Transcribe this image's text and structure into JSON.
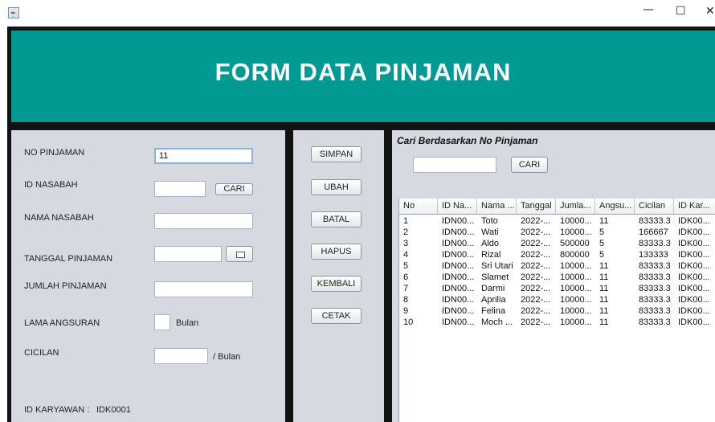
{
  "window": {
    "minimize": "—",
    "maximize": "☐",
    "close": "✕"
  },
  "header": {
    "title": "FORM DATA PINJAMAN"
  },
  "form": {
    "no_pinjaman_label": "NO PINJAMAN",
    "no_pinjaman_value": "11",
    "id_nasabah_label": "ID NASABAH",
    "id_nasabah_value": "",
    "cari_label": "CARI",
    "nama_nasabah_label": "NAMA NASABAH",
    "nama_nasabah_value": "",
    "tanggal_label": "TANGGAL PINJAMAN",
    "tanggal_value": "",
    "jumlah_label": "JUMLAH PINJAMAN",
    "jumlah_value": "",
    "lama_label": "LAMA ANGSURAN",
    "lama_value": "",
    "bulan_label": "Bulan",
    "cicilan_label": "CICILAN",
    "cicilan_value": "",
    "per_bulan_label": "/ Bulan",
    "id_karyawan_label": "ID KARYAWAN :",
    "id_karyawan_value": "IDK0001"
  },
  "actions": {
    "simpan": "SIMPAN",
    "ubah": "UBAH",
    "batal": "BATAL",
    "hapus": "HAPUS",
    "kembali": "KEMBALI",
    "cetak": "CETAK"
  },
  "search": {
    "title": "Cari Berdasarkan No Pinjaman",
    "value": "",
    "button": "CARI"
  },
  "table": {
    "headers": [
      "No",
      "ID Na...",
      "Nama ...",
      "Tanggal",
      "Jumla...",
      "Angsu...",
      "Cicilan",
      "ID Kar..."
    ],
    "rows": [
      [
        "1",
        "IDN00...",
        "Toto",
        "2022-...",
        "10000...",
        "11",
        "83333.3",
        "IDK00..."
      ],
      [
        "2",
        "IDN00...",
        "Wati",
        "2022-...",
        "10000...",
        "5",
        "166667",
        "IDK00..."
      ],
      [
        "3",
        "IDN00...",
        "Aldo",
        "2022-...",
        "500000",
        "5",
        "83333.3",
        "IDK00..."
      ],
      [
        "4",
        "IDN00...",
        "Rizal",
        "2022-...",
        "800000",
        "5",
        "133333",
        "IDK00..."
      ],
      [
        "5",
        "IDN00...",
        "Sri Utari",
        "2022-...",
        "10000...",
        "11",
        "83333.3",
        "IDK00..."
      ],
      [
        "6",
        "IDN00...",
        "Slamet",
        "2022-...",
        "10000...",
        "11",
        "83333.3",
        "IDK00..."
      ],
      [
        "7",
        "IDN00...",
        "Darmi",
        "2022-...",
        "10000...",
        "11",
        "83333.3",
        "IDK00..."
      ],
      [
        "8",
        "IDN00...",
        "Aprilia",
        "2022-...",
        "10000...",
        "11",
        "83333.3",
        "IDK00..."
      ],
      [
        "9",
        "IDN00...",
        "Felina",
        "2022-...",
        "10000...",
        "11",
        "83333.3",
        "IDK00..."
      ],
      [
        "10",
        "IDN00...",
        "Moch ...",
        "2022-...",
        "10000...",
        "11",
        "83333.3",
        "IDK00..."
      ]
    ]
  },
  "colors": {
    "header_bg": "#009a93",
    "panel_bg": "#d6d9df",
    "frame_bg": "#121212"
  }
}
